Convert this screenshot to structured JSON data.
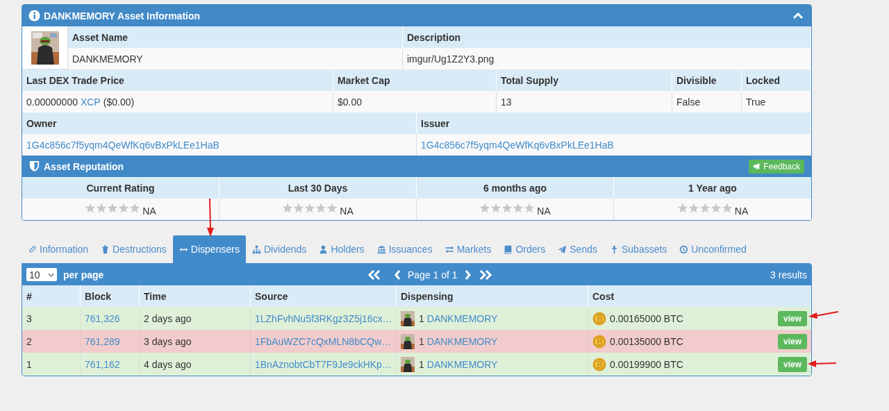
{
  "asset_panel": {
    "title": "DANKMEMORY Asset Information",
    "rows": [
      [
        {
          "label": "Asset Name",
          "value": "DANKMEMORY"
        },
        {
          "label": "Description",
          "value": "imgur/Ug1Z2Y3.png"
        }
      ],
      [
        {
          "label": "Last DEX Trade Price",
          "value": "0.00000000",
          "link": "XCP",
          "suffix": "($0.00)"
        },
        {
          "label": "Market Cap",
          "value": "$0.00"
        },
        {
          "label": "Total Supply",
          "value": "13"
        },
        {
          "label": "Divisible",
          "value": "False"
        },
        {
          "label": "Locked",
          "value": "True"
        }
      ],
      [
        {
          "label": "Owner",
          "link": "1G4c856c7f5yqm4QeWfKq6vBxPkLEe1HaB"
        },
        {
          "label": "Issuer",
          "link": "1G4c856c7f5yqm4QeWfKq6vBxPkLEe1HaB"
        }
      ]
    ]
  },
  "reputation": {
    "title": "Asset Reputation",
    "feedback_button": "Feedback",
    "ratings": [
      {
        "label": "Current Rating",
        "stars": 0,
        "value": "NA"
      },
      {
        "label": "Last 30 Days",
        "stars": 0,
        "value": "NA"
      },
      {
        "label": "6 months ago",
        "stars": 0,
        "value": "NA"
      },
      {
        "label": "1 Year ago",
        "stars": 0,
        "value": "NA"
      }
    ]
  },
  "tabs": [
    {
      "label": "Information",
      "selected": false
    },
    {
      "label": "Destructions",
      "selected": false
    },
    {
      "label": "Dispensers",
      "selected": true
    },
    {
      "label": "Dividends",
      "selected": false
    },
    {
      "label": "Holders",
      "selected": false
    },
    {
      "label": "Issuances",
      "selected": false
    },
    {
      "label": "Markets",
      "selected": false
    },
    {
      "label": "Orders",
      "selected": false
    },
    {
      "label": "Sends",
      "selected": false
    },
    {
      "label": "Subassets",
      "selected": false
    },
    {
      "label": "Unconfirmed",
      "selected": false
    }
  ],
  "dispensers": {
    "per_page": "10",
    "per_page_label": "per page",
    "page_text": "Page 1 of 1",
    "results": "3 results",
    "columns": [
      "#",
      "Block",
      "Time",
      "Source",
      "Dispensing",
      "Cost"
    ],
    "rows": [
      {
        "active": true,
        "number": "3",
        "block": "761,326",
        "time": "2 days ago",
        "source": "1LZhFvhNu5f3RKgz3Z5j16cx…",
        "quantity": "1",
        "asset": "DANKMEMORY",
        "cost": "0.00165000 BTC",
        "button": "view"
      },
      {
        "active": false,
        "number": "2",
        "block": "761,289",
        "time": "3 days ago",
        "source": "1FbAuWZC7cQxMLN8bCQw…",
        "quantity": "1",
        "asset": "DANKMEMORY",
        "cost": "0.00135000 BTC",
        "button": "view"
      },
      {
        "active": true,
        "number": "1",
        "block": "761,162",
        "time": "4 days ago",
        "source": "1BnAznobtCbT7F9Je9ckHKp…",
        "quantity": "1",
        "asset": "DANKMEMORY",
        "cost": "0.00199900 BTC",
        "button": "view"
      }
    ]
  }
}
